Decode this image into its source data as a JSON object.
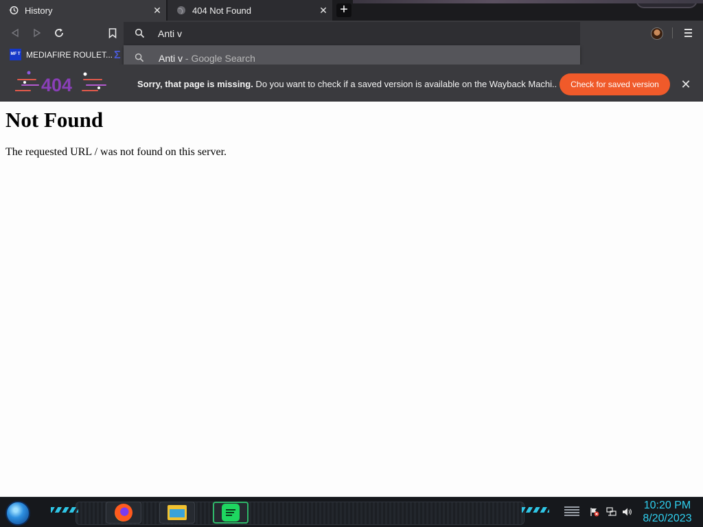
{
  "tabs": [
    {
      "title": "History",
      "icon": "history-icon"
    },
    {
      "title": "404 Not Found",
      "icon": "globe-icon"
    }
  ],
  "toolbar": {
    "omnibox_value": "Anti v"
  },
  "bookmarks": {
    "items": [
      {
        "label": "MEDIAFIRE ROULET...",
        "icon": "mediafire-icon",
        "icon_text": "MF T"
      }
    ]
  },
  "suggestion": {
    "query": "Anti v",
    "separator": " - ",
    "source": "Google Search"
  },
  "banner": {
    "logo_text": "404",
    "message_bold": "Sorry, that page is missing.",
    "message": " Do you want to check if a saved version is available on the Wayback Machi...",
    "button_label": "Check for saved version",
    "accent_color": "#f05a2a"
  },
  "page": {
    "heading": "Not Found",
    "body": "The requested URL / was not found on this server."
  },
  "taskbar": {
    "apps": [
      "firefox-icon",
      "file-explorer-icon",
      "notes-app-icon"
    ],
    "clock_time": "10:20 PM",
    "clock_date": "8/20/2023",
    "clock_color": "#2fd0f0"
  }
}
